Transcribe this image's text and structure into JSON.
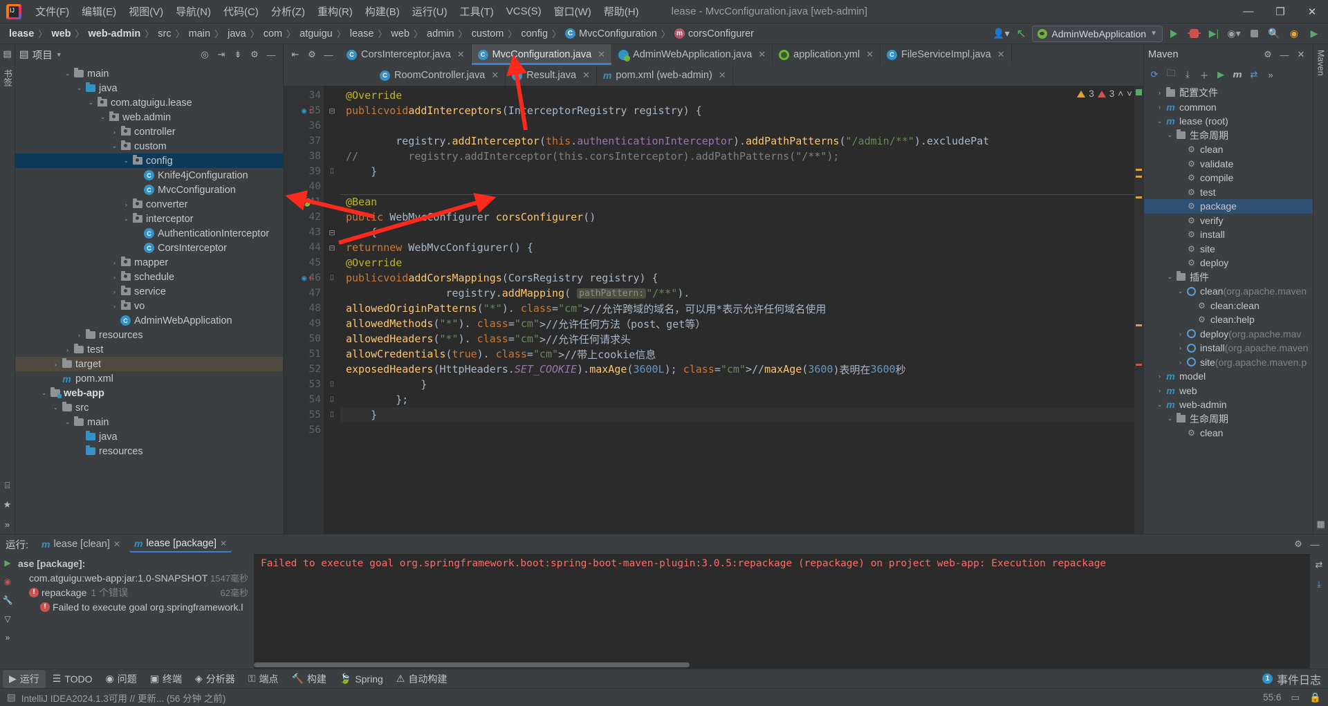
{
  "title_bar": {
    "window_title": "lease - MvcConfiguration.java [web-admin]",
    "menus": [
      "文件(F)",
      "编辑(E)",
      "视图(V)",
      "导航(N)",
      "代码(C)",
      "分析(Z)",
      "重构(R)",
      "构建(B)",
      "运行(U)",
      "工具(T)",
      "VCS(S)",
      "窗口(W)",
      "帮助(H)"
    ],
    "controls": {
      "minimize": "—",
      "maximize": "❐",
      "close": "✕"
    }
  },
  "navbar": {
    "breadcrumbs": [
      {
        "label": "lease",
        "bold": true,
        "icon": null
      },
      {
        "label": "web",
        "bold": true,
        "icon": null
      },
      {
        "label": "web-admin",
        "bold": true,
        "icon": null
      },
      {
        "label": "src",
        "bold": false,
        "icon": null
      },
      {
        "label": "main",
        "bold": false,
        "icon": null
      },
      {
        "label": "java",
        "bold": false,
        "icon": null
      },
      {
        "label": "com",
        "bold": false,
        "icon": null
      },
      {
        "label": "atguigu",
        "bold": false,
        "icon": null
      },
      {
        "label": "lease",
        "bold": false,
        "icon": null
      },
      {
        "label": "web",
        "bold": false,
        "icon": null
      },
      {
        "label": "admin",
        "bold": false,
        "icon": null
      },
      {
        "label": "custom",
        "bold": false,
        "icon": null
      },
      {
        "label": "config",
        "bold": false,
        "icon": null
      },
      {
        "label": "MvcConfiguration",
        "bold": false,
        "icon": "class"
      },
      {
        "label": "corsConfigurer",
        "bold": false,
        "icon": "method"
      }
    ],
    "run_configuration": "AdminWebApplication",
    "icons": [
      "user-dropdown-icon",
      "git-update-icon",
      "run-icon",
      "debug-icon",
      "run-coverage-icon",
      "more-run-icon",
      "stop-icon",
      "search-icon",
      "notifications-icon",
      "ai-icon"
    ]
  },
  "project_panel": {
    "title": "项目",
    "tools": [
      "locate-icon",
      "collapse-all-icon",
      "expand-all-icon",
      "settings-icon",
      "hide-icon"
    ],
    "tree": [
      {
        "depth": 4,
        "label": "main",
        "icon": "folder",
        "arrow": "open",
        "bold": false
      },
      {
        "depth": 5,
        "label": "java",
        "icon": "folder-blue",
        "arrow": "open",
        "bold": false
      },
      {
        "depth": 6,
        "label": "com.atguigu.lease",
        "icon": "package",
        "arrow": "open",
        "bold": false
      },
      {
        "depth": 7,
        "label": "web.admin",
        "icon": "package",
        "arrow": "open",
        "bold": false
      },
      {
        "depth": 8,
        "label": "controller",
        "icon": "package",
        "arrow": "closed",
        "bold": false
      },
      {
        "depth": 8,
        "label": "custom",
        "icon": "package",
        "arrow": "open",
        "bold": false
      },
      {
        "depth": 9,
        "label": "config",
        "icon": "package",
        "arrow": "open",
        "bold": false,
        "selected": true
      },
      {
        "depth": 10,
        "label": "Knife4jConfiguration",
        "icon": "class",
        "arrow": "none",
        "bold": false
      },
      {
        "depth": 10,
        "label": "MvcConfiguration",
        "icon": "class",
        "arrow": "none",
        "bold": false
      },
      {
        "depth": 9,
        "label": "converter",
        "icon": "package",
        "arrow": "closed",
        "bold": false
      },
      {
        "depth": 9,
        "label": "interceptor",
        "icon": "package",
        "arrow": "open",
        "bold": false
      },
      {
        "depth": 10,
        "label": "AuthenticationInterceptor",
        "icon": "class",
        "arrow": "none",
        "bold": false
      },
      {
        "depth": 10,
        "label": "CorsInterceptor",
        "icon": "class",
        "arrow": "none",
        "bold": false
      },
      {
        "depth": 8,
        "label": "mapper",
        "icon": "package",
        "arrow": "closed",
        "bold": false
      },
      {
        "depth": 8,
        "label": "schedule",
        "icon": "package",
        "arrow": "closed",
        "bold": false
      },
      {
        "depth": 8,
        "label": "service",
        "icon": "package",
        "arrow": "closed",
        "bold": false
      },
      {
        "depth": 8,
        "label": "vo",
        "icon": "package",
        "arrow": "closed",
        "bold": false
      },
      {
        "depth": 8,
        "label": "AdminWebApplication",
        "icon": "class-spring",
        "arrow": "none",
        "bold": false
      },
      {
        "depth": 5,
        "label": "resources",
        "icon": "folder",
        "arrow": "closed",
        "bold": false
      },
      {
        "depth": 4,
        "label": "test",
        "icon": "folder",
        "arrow": "closed",
        "bold": false
      },
      {
        "depth": 3,
        "label": "target",
        "icon": "folder",
        "arrow": "closed",
        "bold": false,
        "highlight": true
      },
      {
        "depth": 3,
        "label": "pom.xml",
        "icon": "maven",
        "arrow": "none",
        "bold": false
      },
      {
        "depth": 2,
        "label": "web-app",
        "icon": "module",
        "arrow": "open",
        "bold": true
      },
      {
        "depth": 3,
        "label": "src",
        "icon": "folder",
        "arrow": "open",
        "bold": false
      },
      {
        "depth": 4,
        "label": "main",
        "icon": "folder",
        "arrow": "open",
        "bold": false
      },
      {
        "depth": 5,
        "label": "java",
        "icon": "folder-blue",
        "arrow": "none",
        "bold": false
      },
      {
        "depth": 5,
        "label": "resources",
        "icon": "folder-blue",
        "arrow": "none",
        "bold": false
      }
    ]
  },
  "editor": {
    "tabs_row1": [
      {
        "label": "CorsInterceptor.java",
        "icon": "java-class",
        "active": false
      },
      {
        "label": "MvcConfiguration.java",
        "icon": "java-class",
        "active": true
      },
      {
        "label": "AdminWebApplication.java",
        "icon": "spring-class",
        "active": false
      },
      {
        "label": "application.yml",
        "icon": "yaml-spring",
        "active": false
      },
      {
        "label": "FileServiceImpl.java",
        "icon": "java-class",
        "active": false
      }
    ],
    "tabs_row2": [
      {
        "label": "RoomController.java",
        "icon": "java-class",
        "active": false
      },
      {
        "label": "Result.java",
        "icon": "java-class",
        "active": false
      },
      {
        "label": "pom.xml (web-admin)",
        "icon": "maven",
        "active": false
      }
    ],
    "inspection": {
      "warnings": "3",
      "errors": "3"
    },
    "lines": [
      {
        "n": 34,
        "text": "    @Override",
        "gutter": "",
        "fold": ""
      },
      {
        "n": 35,
        "text": "    public void addInterceptors(InterceptorRegistry registry) {",
        "gutter": "override-implement",
        "fold": "fold-open"
      },
      {
        "n": 36,
        "text": "",
        "gutter": "",
        "fold": ""
      },
      {
        "n": 37,
        "text": "        registry.addInterceptor(this.authenticationInterceptor).addPathPatterns(\"/admin/**\").excludePat",
        "gutter": "",
        "fold": ""
      },
      {
        "n": 38,
        "text": "//        registry.addInterceptor(this.corsInterceptor).addPathPatterns(\"/**\");",
        "gutter": "",
        "fold": ""
      },
      {
        "n": 39,
        "text": "    }",
        "gutter": "",
        "fold": "fold-end"
      },
      {
        "n": 40,
        "text": "",
        "gutter": "",
        "fold": ""
      },
      {
        "n": 41,
        "text": "    @Bean",
        "gutter": "bean-leaf",
        "fold": ""
      },
      {
        "n": 42,
        "text": "    public WebMvcConfigurer corsConfigurer()",
        "gutter": "",
        "fold": ""
      },
      {
        "n": 43,
        "text": "    {",
        "gutter": "",
        "fold": "fold-open"
      },
      {
        "n": 44,
        "text": "        return new WebMvcConfigurer() {",
        "gutter": "",
        "fold": "fold-open"
      },
      {
        "n": 45,
        "text": "            @Override",
        "gutter": "",
        "fold": ""
      },
      {
        "n": 46,
        "text": "            public void addCorsMappings(CorsRegistry registry) {",
        "gutter": "override-implement",
        "fold": "fold-end"
      },
      {
        "n": 47,
        "text": "                registry.addMapping( pathPattern: \"/**\").",
        "gutter": "",
        "fold": ""
      },
      {
        "n": 48,
        "text": "                        allowedOriginPatterns(\"*\"). //允许跨域的域名，可以用*表示允许任何域名使用",
        "gutter": "",
        "fold": ""
      },
      {
        "n": 49,
        "text": "                        allowedMethods(\"*\"). //允许任何方法（post、get等）",
        "gutter": "",
        "fold": ""
      },
      {
        "n": 50,
        "text": "                        allowedHeaders(\"*\"). //允许任何请求头",
        "gutter": "",
        "fold": ""
      },
      {
        "n": 51,
        "text": "                        allowCredentials(true). //带上cookie信息",
        "gutter": "",
        "fold": ""
      },
      {
        "n": 52,
        "text": "                        exposedHeaders(HttpHeaders.SET_COOKIE).maxAge(3600L); //maxAge(3600)表明在3600秒",
        "gutter": "",
        "fold": ""
      },
      {
        "n": 53,
        "text": "            }",
        "gutter": "",
        "fold": "fold-end"
      },
      {
        "n": 54,
        "text": "        };",
        "gutter": "",
        "fold": "fold-end"
      },
      {
        "n": 55,
        "text": "    }",
        "gutter": "",
        "fold": "fold-end",
        "current": true
      },
      {
        "n": 56,
        "text": "",
        "gutter": "",
        "fold": ""
      }
    ]
  },
  "maven_panel": {
    "title": "Maven",
    "tools": [
      "refresh-icon",
      "add-maven-icon",
      "download-sources-icon",
      "add-icon",
      "run-icon",
      "skip-tests-icon",
      "toggle-offline-icon",
      "more-icon"
    ],
    "tree": [
      {
        "depth": 1,
        "label": "配置文件",
        "icon": "folder",
        "arrow": "closed"
      },
      {
        "depth": 1,
        "label": "common",
        "icon": "maven-module",
        "arrow": "closed"
      },
      {
        "depth": 1,
        "label": "lease (root)",
        "icon": "maven-module",
        "arrow": "open"
      },
      {
        "depth": 2,
        "label": "生命周期",
        "icon": "lifecycle",
        "arrow": "open"
      },
      {
        "depth": 3,
        "label": "clean",
        "icon": "goal",
        "arrow": "none"
      },
      {
        "depth": 3,
        "label": "validate",
        "icon": "goal",
        "arrow": "none"
      },
      {
        "depth": 3,
        "label": "compile",
        "icon": "goal",
        "arrow": "none"
      },
      {
        "depth": 3,
        "label": "test",
        "icon": "goal",
        "arrow": "none"
      },
      {
        "depth": 3,
        "label": "package",
        "icon": "goal",
        "arrow": "none",
        "selected": true
      },
      {
        "depth": 3,
        "label": "verify",
        "icon": "goal",
        "arrow": "none"
      },
      {
        "depth": 3,
        "label": "install",
        "icon": "goal",
        "arrow": "none"
      },
      {
        "depth": 3,
        "label": "site",
        "icon": "goal",
        "arrow": "none"
      },
      {
        "depth": 3,
        "label": "deploy",
        "icon": "goal",
        "arrow": "none"
      },
      {
        "depth": 2,
        "label": "插件",
        "icon": "lifecycle",
        "arrow": "open"
      },
      {
        "depth": 3,
        "label": "clean",
        "suffix": "(org.apache.maven",
        "icon": "plugin",
        "arrow": "open"
      },
      {
        "depth": 4,
        "label": "clean:clean",
        "icon": "goal",
        "arrow": "none"
      },
      {
        "depth": 4,
        "label": "clean:help",
        "icon": "goal",
        "arrow": "none"
      },
      {
        "depth": 3,
        "label": "deploy",
        "suffix": "(org.apache.mav",
        "icon": "plugin",
        "arrow": "closed"
      },
      {
        "depth": 3,
        "label": "install",
        "suffix": "(org.apache.maven",
        "icon": "plugin",
        "arrow": "closed"
      },
      {
        "depth": 3,
        "label": "site",
        "suffix": "(org.apache.maven.p",
        "icon": "plugin",
        "arrow": "closed"
      },
      {
        "depth": 1,
        "label": "model",
        "icon": "maven-module",
        "arrow": "closed"
      },
      {
        "depth": 1,
        "label": "web",
        "icon": "maven-module",
        "arrow": "closed"
      },
      {
        "depth": 1,
        "label": "web-admin",
        "icon": "maven-module",
        "arrow": "open"
      },
      {
        "depth": 2,
        "label": "生命周期",
        "icon": "lifecycle",
        "arrow": "open"
      },
      {
        "depth": 3,
        "label": "clean",
        "icon": "goal",
        "arrow": "none"
      }
    ]
  },
  "run_panel": {
    "label": "运行:",
    "tabs": [
      {
        "label": "lease [clean]",
        "icon": "maven",
        "active": false
      },
      {
        "label": "lease [package]",
        "icon": "maven",
        "active": true
      }
    ],
    "tools": [
      "settings-icon",
      "hide-icon"
    ],
    "side_icons": [
      "rerun-icon",
      "show-failed-icon",
      "wrench-icon",
      "filter-icon",
      "expand-icon"
    ],
    "tree": [
      {
        "depth": 0,
        "label": "ase [package]:",
        "bold": true,
        "icon": "none",
        "time": ""
      },
      {
        "depth": 1,
        "label": "com.atguigu:web-app:jar:1.0-SNAPSHOT",
        "icon": "none",
        "time": "1547毫秒"
      },
      {
        "depth": 1,
        "label": "repackage",
        "suffix": "1 个错误",
        "icon": "error",
        "time": "62毫秒"
      },
      {
        "depth": 2,
        "label": "Failed to execute goal org.springframework.l",
        "icon": "error",
        "time": ""
      }
    ],
    "console": "Failed to execute goal org.springframework.boot:spring-boot-maven-plugin:3.0.5:repackage (repackage) on project web-app: Execution repackage",
    "console_rail": [
      "wrap-icon",
      "download-icon"
    ]
  },
  "tool_strip": {
    "items": [
      {
        "label": "运行",
        "icon": "run-icon",
        "active": true
      },
      {
        "label": "TODO",
        "icon": "list-icon",
        "active": false
      },
      {
        "label": "问题",
        "icon": "problems-icon",
        "active": false
      },
      {
        "label": "终端",
        "icon": "terminal-icon",
        "active": false
      },
      {
        "label": "分析器",
        "icon": "profiler-icon",
        "active": false
      },
      {
        "label": "端点",
        "icon": "endpoints-icon",
        "active": false
      },
      {
        "label": "构建",
        "icon": "build-icon",
        "active": false
      },
      {
        "label": "Spring",
        "icon": "spring-icon",
        "active": false
      },
      {
        "label": "自动构建",
        "icon": "auto-build-icon",
        "active": false
      }
    ],
    "right": {
      "count": "1",
      "label": "事件日志"
    }
  },
  "status_bar": {
    "left": "IntelliJ IDEA2024.1.3可用 // 更新... (56 分钟 之前)",
    "caret": "55:6",
    "icons": [
      "memory-icon",
      "lock-icon"
    ]
  },
  "colors": {
    "accent_blue": "#3c7fd4",
    "error_red": "#ff6b68",
    "warn_yellow": "#d9a343",
    "spring_green": "#6db33f",
    "annotation": "#bbb529",
    "keyword": "#cc7832",
    "string": "#6a8759",
    "comment": "#808080",
    "method": "#ffc66d",
    "field": "#9876aa",
    "number": "#6897bb"
  }
}
